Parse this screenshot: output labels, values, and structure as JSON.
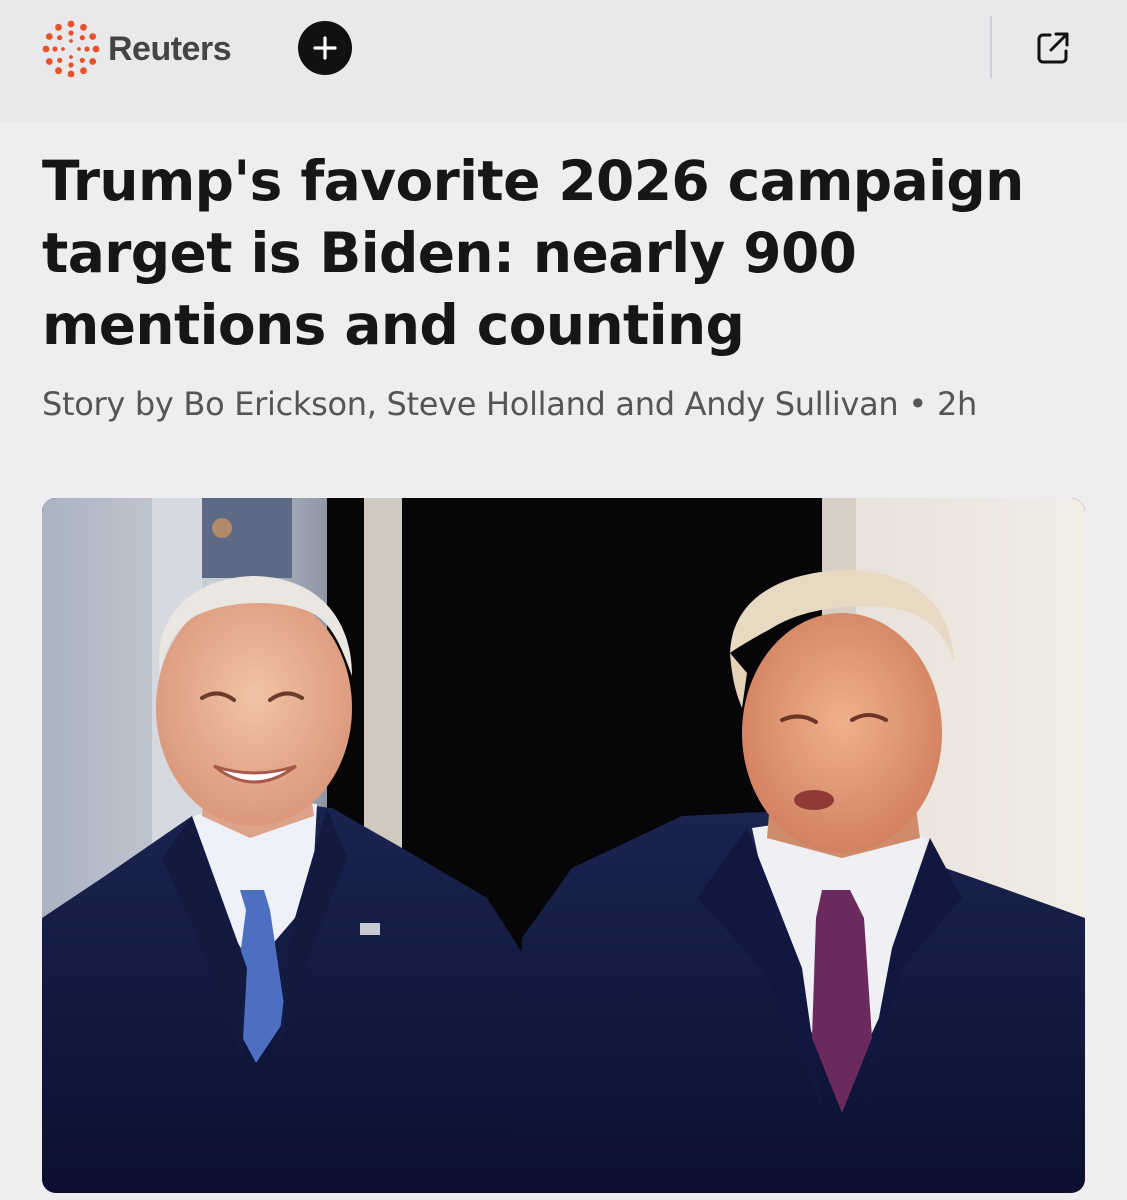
{
  "header": {
    "brand_name": "Reuters",
    "brand_color": "#e5522c",
    "follow_icon": "plus-icon",
    "external_icon": "open-external-icon"
  },
  "article": {
    "headline": "Trump's favorite 2026 campaign target is Biden: nearly 900 mentions and counting",
    "byline": "Story by Bo Erickson, Steve Holland and Andy Sullivan",
    "separator": "•",
    "age": "2h"
  }
}
